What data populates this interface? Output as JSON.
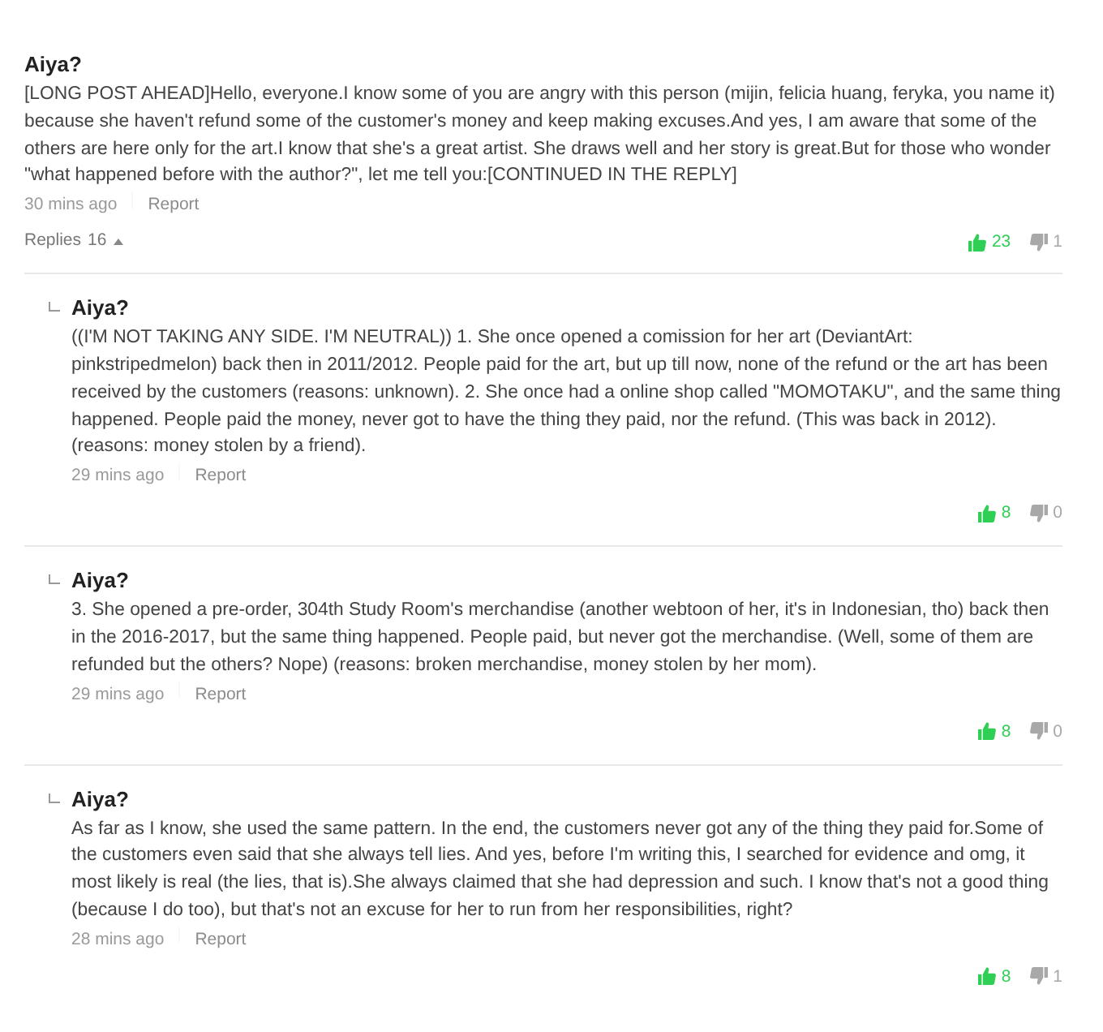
{
  "comment": {
    "author": "Aiya?",
    "text": "[LONG POST AHEAD]Hello, everyone.I know some of you are angry with this person (mijin, felicia huang, feryka, you name it) because she haven't refund some of the customer's money and keep making excuses.And yes, I am aware that some of the others are here only for the art.I know that she's a great artist. She draws well and her story is great.But for those who wonder \"what happened before with the author?\", let me tell you:[CONTINUED IN THE REPLY]",
    "time": "30 mins ago",
    "report": "Report",
    "replies_toggle": {
      "label": "Replies",
      "count": "16",
      "expanded": true
    },
    "likes": "23",
    "dislikes": "1"
  },
  "replies": [
    {
      "author": "Aiya?",
      "text": "((I'M NOT TAKING ANY SIDE. I'M NEUTRAL)) 1. She once opened a comission for her art (DeviantArt: pinkstripedmelon) back then in 2011/2012. People paid for the art, but up till now, none of the refund or the art has been received by the customers (reasons: unknown). 2. She once had a online shop called \"MOMOTAKU\", and the same thing happened. People paid the money, never got to have the thing they paid, nor the refund. (This was back in 2012). (reasons: money stolen by a friend).",
      "time": "29 mins ago",
      "report": "Report",
      "likes": "8",
      "dislikes": "0"
    },
    {
      "author": "Aiya?",
      "text": "3. She opened a pre-order, 304th Study Room's merchandise (another webtoon of her, it's in Indonesian, tho) back then in the 2016-2017, but the same thing happened. People paid, but never got the merchandise. (Well, some of them are refunded but the others? Nope) (reasons: broken merchandise, money stolen by her mom).",
      "time": "29 mins ago",
      "report": "Report",
      "likes": "8",
      "dislikes": "0"
    },
    {
      "author": "Aiya?",
      "text": "As far as I know, she used the same pattern. In the end, the customers never got any of the thing they paid for.Some of the customers even said that she always tell lies. And yes, before I'm writing this, I searched for evidence and omg, it most likely is real (the lies, that is).She always claimed that she had depression and such. I know that's not a good thing (because I do too), but that's not an excuse for her to run from her responsibilities, right?",
      "time": "28 mins ago",
      "report": "Report",
      "likes": "8",
      "dislikes": "1"
    }
  ]
}
